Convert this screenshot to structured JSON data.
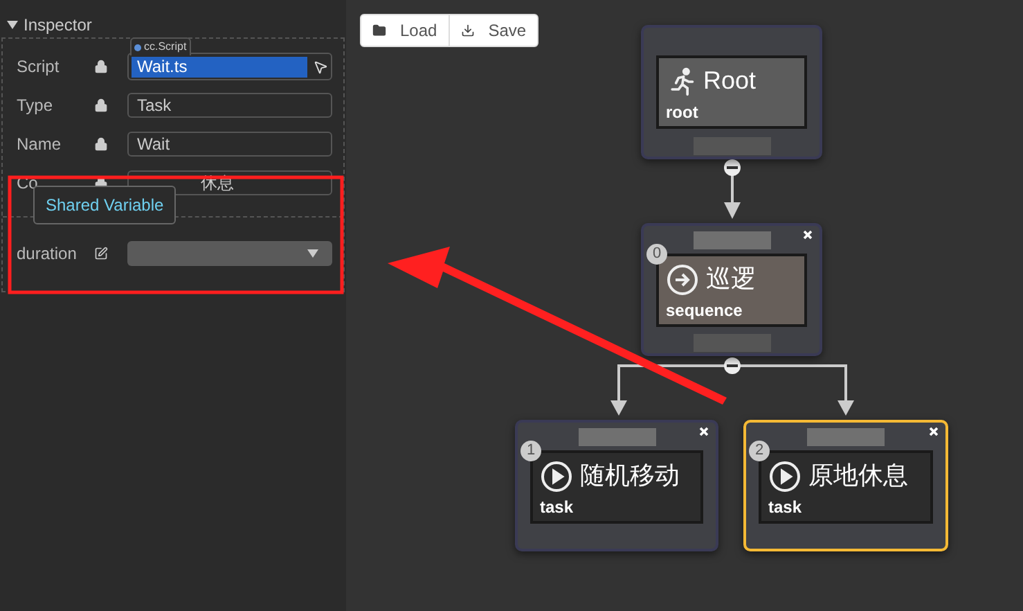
{
  "inspector": {
    "title": "Inspector",
    "script_tag": "cc.Script",
    "fields": [
      {
        "label": "Script",
        "kind": "script",
        "value": "Wait.ts"
      },
      {
        "label": "Type",
        "kind": "text",
        "value": "Task"
      },
      {
        "label": "Name",
        "kind": "text",
        "value": "Wait"
      },
      {
        "label": "Co",
        "kind": "text",
        "value": "休息"
      },
      {
        "label": "duration",
        "kind": "select"
      }
    ],
    "tooltip": "Shared Variable"
  },
  "toolbar": [
    "Load",
    "Save"
  ],
  "nodes": [
    {
      "title": "Root",
      "type": "root",
      "kind": "root",
      "selected": false
    },
    {
      "index": "0",
      "title": "巡逻",
      "type": "sequence",
      "kind": "composite",
      "selected": false
    },
    {
      "index": "1",
      "title": "随机移动",
      "type": "task",
      "kind": "task",
      "selected": false
    },
    {
      "index": "2",
      "title": "原地休息",
      "type": "task",
      "kind": "task",
      "selected": true
    }
  ]
}
